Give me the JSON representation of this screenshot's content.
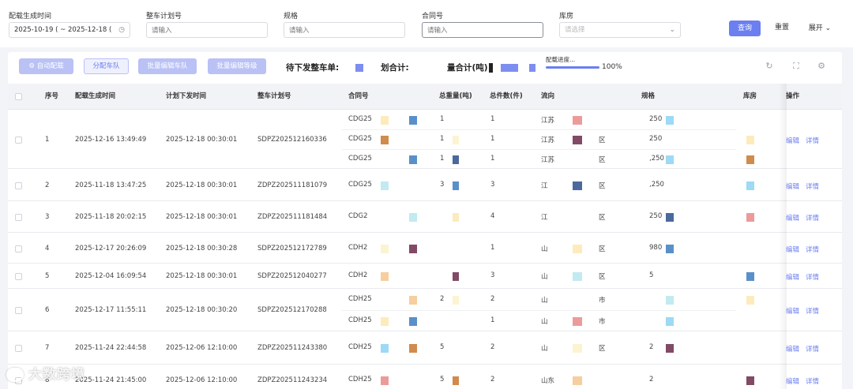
{
  "filters": {
    "gen_time": {
      "label": "配载生成时间",
      "value": "2025-10-19 ( ~ 2025-12-18 ("
    },
    "plan_no": {
      "label": "整车计划号",
      "placeholder": "请输入"
    },
    "spec": {
      "label": "规格",
      "placeholder": "请输入"
    },
    "contract": {
      "label": "合同号",
      "placeholder": "请输入"
    },
    "warehouse": {
      "label": "库房",
      "placeholder": "请选择"
    },
    "search_label": "查询",
    "reset_label": "重置",
    "expand_label": "展开"
  },
  "toolbar": {
    "auto_label": "自动配载",
    "assign_label": "分配车队",
    "batch_team_label": "批量编辑车队",
    "batch_grade_label": "批量编辑等级",
    "pending_label": "待下发整车单:",
    "plan_total_label": "划合计:",
    "weight_total_label": "量合计(吨)",
    "progress_label": "配载进度...",
    "progress_value": 1.0,
    "progress_text": "100%"
  },
  "columns": {
    "index": "序号",
    "gen_time": "配载生成时间",
    "plan_time": "计划下发时间",
    "plan_no": "整车计划号",
    "contract": "合同号",
    "weight": "总重量(吨)",
    "count": "总件数(件)",
    "flow": "流向",
    "spec": "规格",
    "warehouse": "库房",
    "ops": "操作"
  },
  "rows": [
    {
      "index": "1",
      "gen_time": "2025-12-16 13:49:49",
      "plan_time": "2025-12-18 00:30:01",
      "plan_no": "SDPZ202512160336",
      "subs": [
        {
          "contract": "CDG25",
          "weight": "1",
          "count": "1",
          "flow": "江苏",
          "flow_tail": "",
          "spec": "250"
        },
        {
          "contract": "CDG25",
          "weight": "1",
          "count": "1",
          "flow": "江苏",
          "flow_tail": "区",
          "spec": "250"
        },
        {
          "contract": "CDG25",
          "weight": "1",
          "count": "1",
          "flow": "江苏",
          "flow_tail": "区",
          "spec": ",250"
        }
      ]
    },
    {
      "index": "2",
      "gen_time": "2025-11-18 13:47:25",
      "plan_time": "2025-12-18 00:30:01",
      "plan_no": "ZDPZ202511181079",
      "subs": [
        {
          "contract": "CDG25",
          "weight": "3",
          "count": "3",
          "flow": "江",
          "flow_tail": "区",
          "spec": ",250"
        }
      ]
    },
    {
      "index": "3",
      "gen_time": "2025-11-18 20:02:15",
      "plan_time": "2025-12-18 00:30:01",
      "plan_no": "ZDPZ202511181484",
      "subs": [
        {
          "contract": "CDG2",
          "weight": "",
          "count": "4",
          "flow": "江",
          "flow_tail": "区",
          "spec": "250"
        }
      ]
    },
    {
      "index": "4",
      "gen_time": "2025-12-17 20:26:09",
      "plan_time": "2025-12-18 00:30:28",
      "plan_no": "SDPZ202512172789",
      "subs": [
        {
          "contract": "CDH2",
          "weight": "",
          "count": "1",
          "flow": "山",
          "flow_tail": "区",
          "spec": "980"
        }
      ]
    },
    {
      "index": "5",
      "gen_time": "2025-12-04 16:09:54",
      "plan_time": "2025-12-18 00:30:01",
      "plan_no": "SDPZ202512040277",
      "subs": [
        {
          "contract": "CDH2",
          "weight": "",
          "count": "3",
          "flow": "山",
          "flow_tail": "区",
          "spec": "5"
        }
      ]
    },
    {
      "index": "6",
      "gen_time": "2025-12-17 11:55:11",
      "plan_time": "2025-12-18 00:30:20",
      "plan_no": "SDPZ202512170288",
      "subs": [
        {
          "contract": "CDH25",
          "weight": "2",
          "count": "2",
          "flow": "山",
          "flow_tail": "市",
          "spec": ""
        },
        {
          "contract": "CDH25",
          "weight": "",
          "count": "1",
          "flow": "山",
          "flow_tail": "市",
          "spec": ""
        }
      ]
    },
    {
      "index": "7",
      "gen_time": "2025-11-24 22:44:58",
      "plan_time": "2025-12-06 12:10:00",
      "plan_no": "ZDPZ202511243380",
      "subs": [
        {
          "contract": "CDH25",
          "weight": "5",
          "count": "2",
          "flow": "山",
          "flow_tail": "区",
          "spec": "2"
        }
      ]
    },
    {
      "index": "8",
      "gen_time": "2025-11-24 21:45:00",
      "plan_time": "2025-12-06 12:10:00",
      "plan_no": "ZDPZ202511243234",
      "subs": [
        {
          "contract": "CDH25",
          "weight": "5",
          "count": "2",
          "flow": "山东",
          "flow_tail": "",
          "spec": "2"
        }
      ]
    }
  ],
  "row_actions": {
    "edit": "编辑",
    "detail": "详情"
  },
  "watermark": "大数跨境",
  "colors": {
    "primary": "#6b7ff0",
    "primary_light": "#b9c1f5",
    "header_bg": "#f2f3f6"
  }
}
